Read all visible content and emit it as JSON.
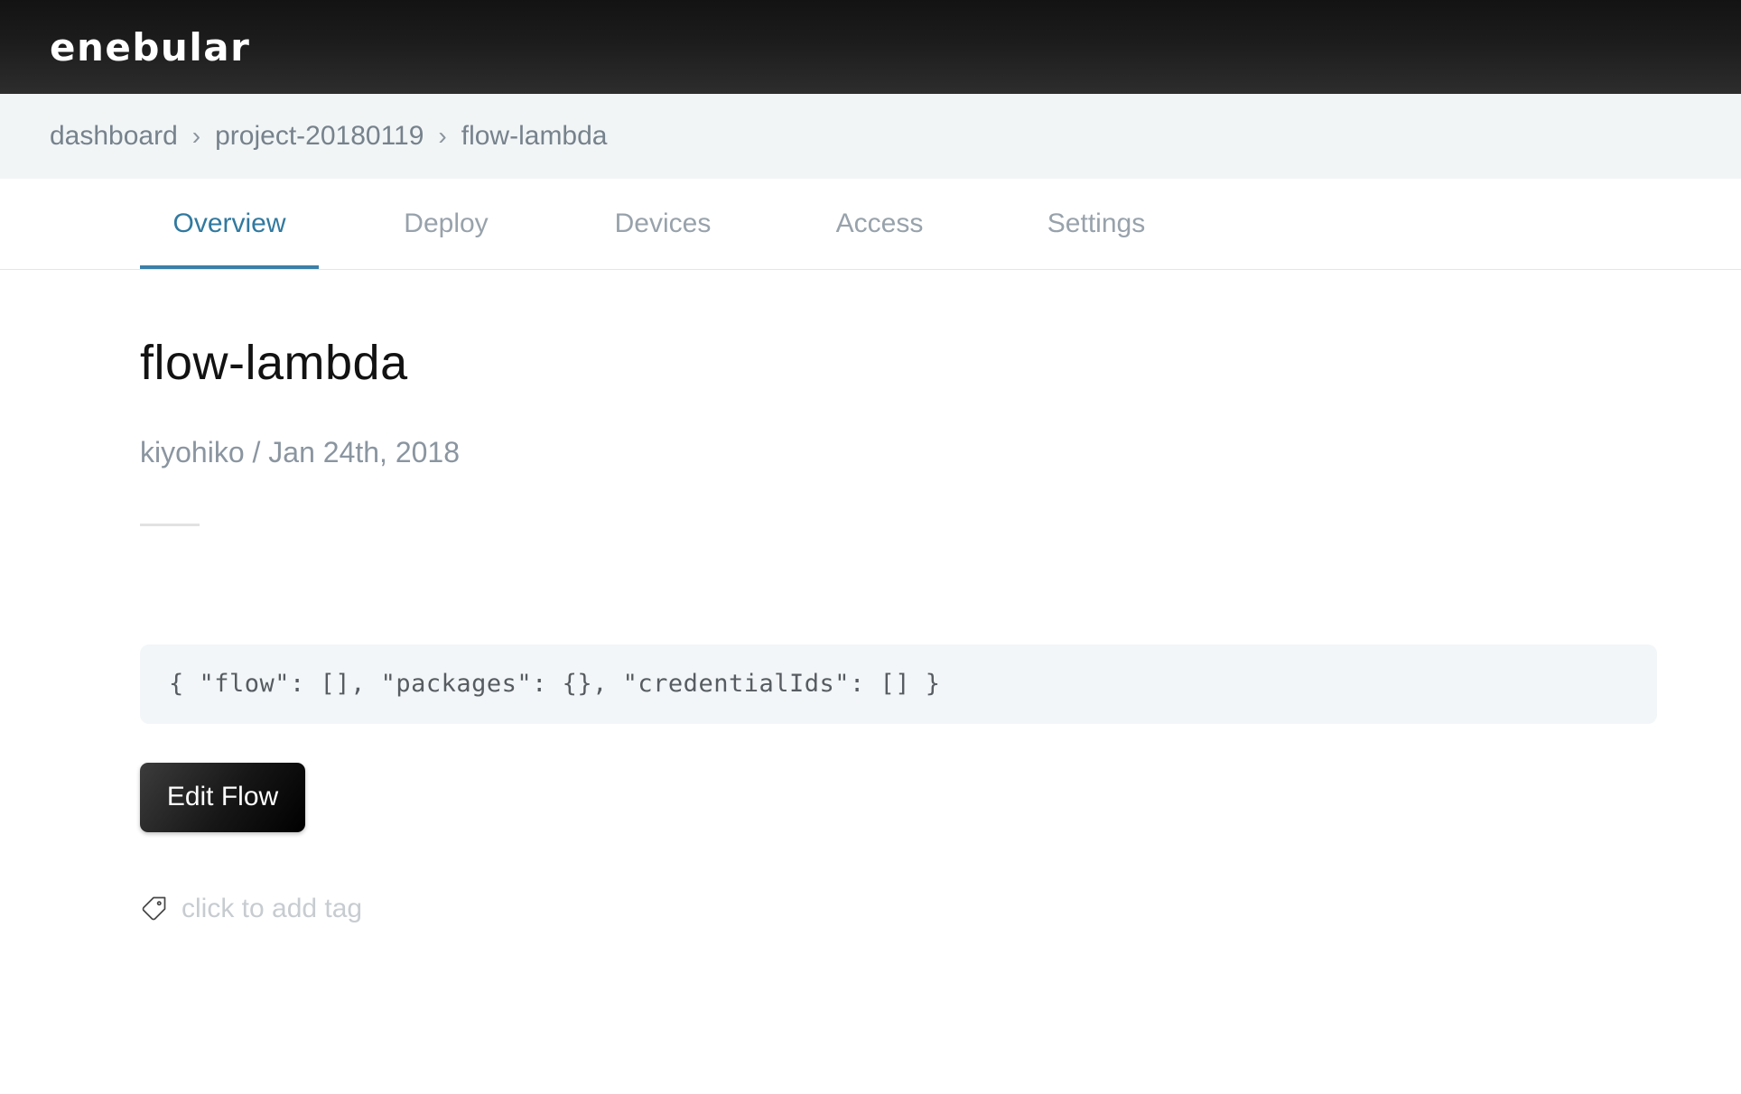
{
  "header": {
    "logo": "enebular"
  },
  "breadcrumb": {
    "separator": "›",
    "items": [
      "dashboard",
      "project-20180119",
      "flow-lambda"
    ]
  },
  "tabs": [
    {
      "label": "Overview",
      "active": true
    },
    {
      "label": "Deploy",
      "active": false
    },
    {
      "label": "Devices",
      "active": false
    },
    {
      "label": "Access",
      "active": false
    },
    {
      "label": "Settings",
      "active": false
    }
  ],
  "flow": {
    "title": "flow-lambda",
    "byline": "kiyohiko / Jan 24th, 2018",
    "code": "{ \"flow\": [], \"packages\": {}, \"credentialIds\": [] }",
    "edit_button_label": "Edit Flow",
    "add_tag_hint": "click to add tag"
  },
  "colors": {
    "accent_blue": "#31799f",
    "tab_underline": "#3b80a8",
    "header_background": "#1d1d1d",
    "breadcrumb_background": "#f2f5f6",
    "code_panel_background": "#f3f6f8",
    "inactive_tab_text": "#98a2ab",
    "breadcrumb_text": "#76828c",
    "byline_text": "#8a95a0",
    "tag_hint_text": "#c7ccd1"
  }
}
